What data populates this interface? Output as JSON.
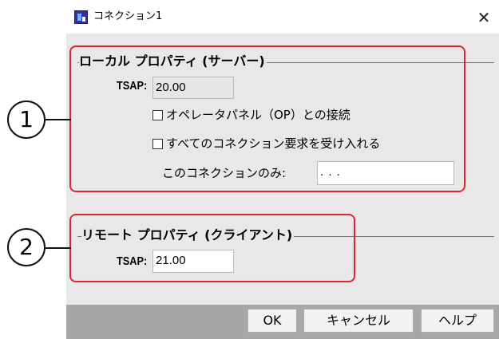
{
  "window": {
    "title": "コネクション1",
    "close_glyph": "✕"
  },
  "local": {
    "group_title": "ローカル プロパティ (サーバー)",
    "tsap_label": "TSAP:",
    "tsap_value": "20.00",
    "checkbox_op_label": "オペレータパネル（OP）との接続",
    "checkbox_all_label": "すべてのコネクション要求を受け入れる",
    "only_label": "このコネクションのみ:",
    "only_value": " .  .  ."
  },
  "remote": {
    "group_title": "リモート プロパティ (クライアント)",
    "tsap_label": "TSAP:",
    "tsap_value": "21.00"
  },
  "buttons": {
    "ok": "OK",
    "cancel": "キャンセル",
    "help": "ヘルプ"
  },
  "annotations": {
    "marker_1": "1",
    "marker_2": "2",
    "highlight_color": "#e0252f"
  }
}
